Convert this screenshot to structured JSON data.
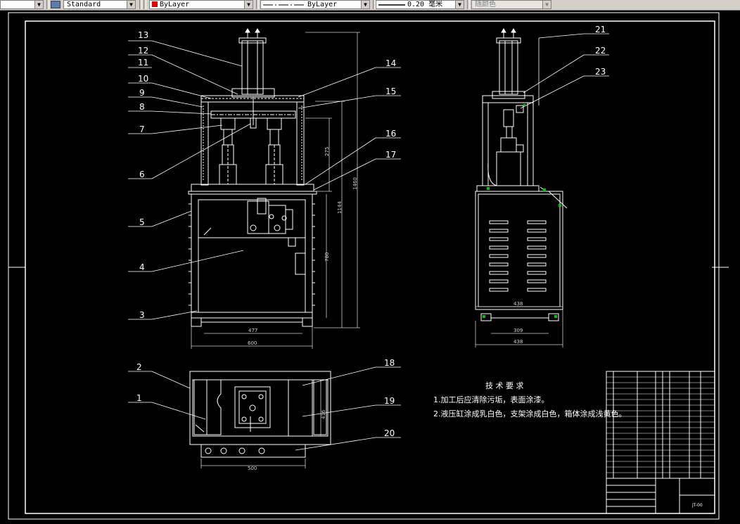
{
  "toolbar": {
    "text_style": "Standard",
    "layer": "ByLayer",
    "linetype": "ByLayer",
    "lineweight": "0.20 毫米",
    "plotstyle": "随颜色",
    "layer_color": "#e00000"
  },
  "drawing": {
    "callouts": [
      "1",
      "2",
      "3",
      "4",
      "5",
      "6",
      "7",
      "8",
      "9",
      "10",
      "11",
      "12",
      "13",
      "14",
      "15",
      "16",
      "17",
      "18",
      "19",
      "20",
      "21",
      "22",
      "23"
    ],
    "dimensions": {
      "front_inner_width": "477",
      "front_outer_width": "600",
      "front_height_total": "1460",
      "front_height_mid": "1144",
      "front_height_lower": "780",
      "front_height_upper": "275",
      "side_width_top": "438",
      "side_width_inner": "309",
      "side_width_bottom": "438",
      "plan_width": "500",
      "plan_depth": "416"
    },
    "notes": {
      "title": "技 术 要 求",
      "line1": "1.加工后应清除污垢，表面涂漆。",
      "line2": "2.液压缸涂成乳白色，支架涂成白色，箱体涂成浅黄色。"
    },
    "title_block": {
      "drawing_no": "JT-00"
    },
    "line_color": "#ffffff",
    "dim_color": "#d0d0d0",
    "accent_color": "#00c000"
  }
}
